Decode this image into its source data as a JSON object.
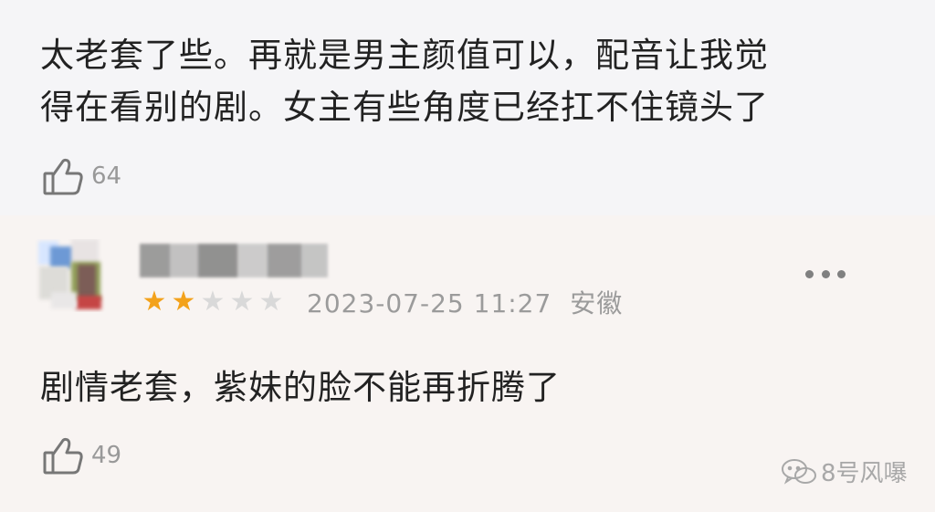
{
  "comments": [
    {
      "text_lines": [
        "太老套了些。再就是男主颜值可以，配音让我觉",
        "得在看别的剧。女主有些角度已经扛不住镜头了"
      ],
      "likes": "64"
    },
    {
      "date": "2023-07-25 11:27",
      "location": "安徽",
      "rating": 2,
      "rating_max": 5,
      "text": "剧情老套，紫妹的脸不能再折腾了",
      "likes": "49",
      "more_icon": "more-horizontal-icon",
      "like_icon": "thumbs-up-icon"
    }
  ],
  "watermark": {
    "text": "8号风嚗",
    "icon": "wechat-icon"
  },
  "colors": {
    "star_filled": "#f3a21b",
    "star_empty": "#d9d9d9"
  }
}
